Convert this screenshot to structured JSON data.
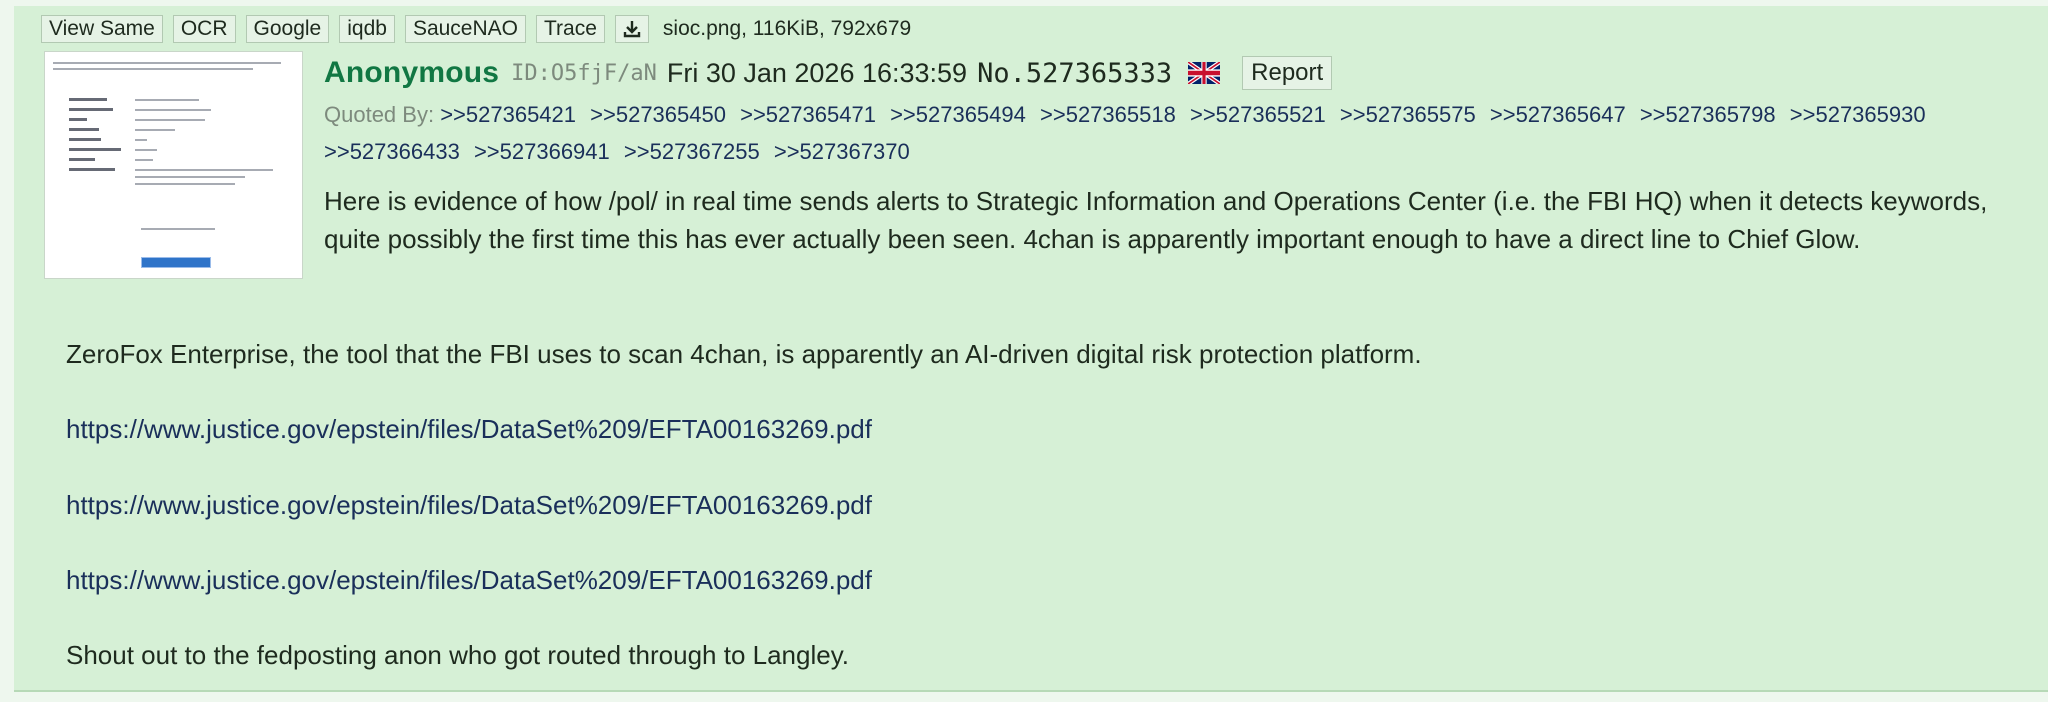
{
  "file": {
    "buttons": [
      "View Same",
      "OCR",
      "Google",
      "iqdb",
      "SauceNAO",
      "Trace"
    ],
    "download_icon": "download-icon",
    "info": "sioc.png, 116KiB, 792x679"
  },
  "post": {
    "name": "Anonymous",
    "poster_id": "ID:O5fjF/aN",
    "datetime": "Fri 30 Jan 2026 16:33:59",
    "post_number": "No.527365333",
    "flag_icon": "uk-flag-icon",
    "report_label": "Report"
  },
  "quoted_by": {
    "label": "Quoted By:",
    "links": [
      ">>527365421",
      ">>527365450",
      ">>527365471",
      ">>527365494",
      ">>527365518",
      ">>527365521",
      ">>527365575",
      ">>527365647",
      ">>527365798",
      ">>527365930",
      ">>527366433",
      ">>527366941",
      ">>527367255",
      ">>527367370"
    ]
  },
  "message": {
    "intro": "Here is evidence of how /pol/ in real time sends alerts to Strategic Information and Operations Center (i.e. the FBI HQ) when it detects keywords, quite possibly the first time this has ever actually been seen. 4chan is apparently important enough to have a direct line to Chief Glow.",
    "zerofox": "ZeroFox Enterprise, the tool that the FBI uses to scan 4chan, is apparently an AI-driven digital risk protection platform.",
    "links": [
      "https://www.justice.gov/epstein/files/DataSet%209/EFTA00163269.pdf",
      "https://www.justice.gov/epstein/files/DataSet%209/EFTA00163269.pdf",
      "https://www.justice.gov/epstein/files/DataSet%209/EFTA00163269.pdf"
    ],
    "closing": "Shout out to the fedposting anon who got routed through to Langley."
  },
  "colors": {
    "post_background": "#d6f0d6",
    "name": "#117743",
    "link": "#1a2f5a",
    "muted": "#7d8a7d"
  }
}
